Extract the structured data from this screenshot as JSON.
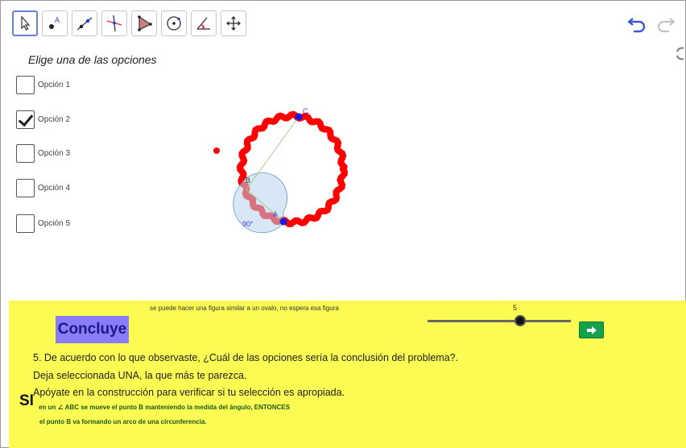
{
  "toolbar": {
    "tools": [
      {
        "name": "move-tool",
        "active": true
      },
      {
        "name": "point-tool"
      },
      {
        "name": "line-tool"
      },
      {
        "name": "perpendicular-tool"
      },
      {
        "name": "polygon-tool"
      },
      {
        "name": "circle-tool"
      },
      {
        "name": "angle-tool"
      },
      {
        "name": "move-view-tool"
      }
    ],
    "undo_icon": "undo-icon",
    "redo_icon": "redo-icon"
  },
  "graphics": {
    "question": "Elige una de las opciones",
    "options": [
      {
        "label": "Opción 1",
        "checked": false
      },
      {
        "label": "Opción 2",
        "checked": true
      },
      {
        "label": "Opción 3",
        "checked": false
      },
      {
        "label": "Opción 4",
        "checked": false
      },
      {
        "label": "Opción 5",
        "checked": false
      }
    ],
    "point_labels": {
      "a": "A",
      "b": "B",
      "c": "C"
    },
    "angle_label": "90°",
    "trace_color": "#ff0000",
    "point_color": "#1a1adf"
  },
  "panel": {
    "note": "se puede hacer una figura similar a un ovalo, no espera esa figura",
    "concluye_button": "Concluye",
    "slider_value": "5",
    "paragraph_1": "5.  De acuerdo con lo que observaste, ¿Cuál de las opciones sería la conclusión del problema?.",
    "paragraph_2": "Deja seleccionada UNA, la que más te parezca.",
    "paragraph_3": "Apóyate en la construcción para verificar si tu selección es apropiada.",
    "si_label": "SI",
    "answer_line_1": "en un ∠ ABC se mueve el punto B manteniendo la medida del ángulo, ENTONCES",
    "answer_line_2": "el punto B va formando un arco de una circunferencia.",
    "background_color": "#fbfb54",
    "button_color": "#8a7bf6",
    "play_color": "#13a14b"
  }
}
